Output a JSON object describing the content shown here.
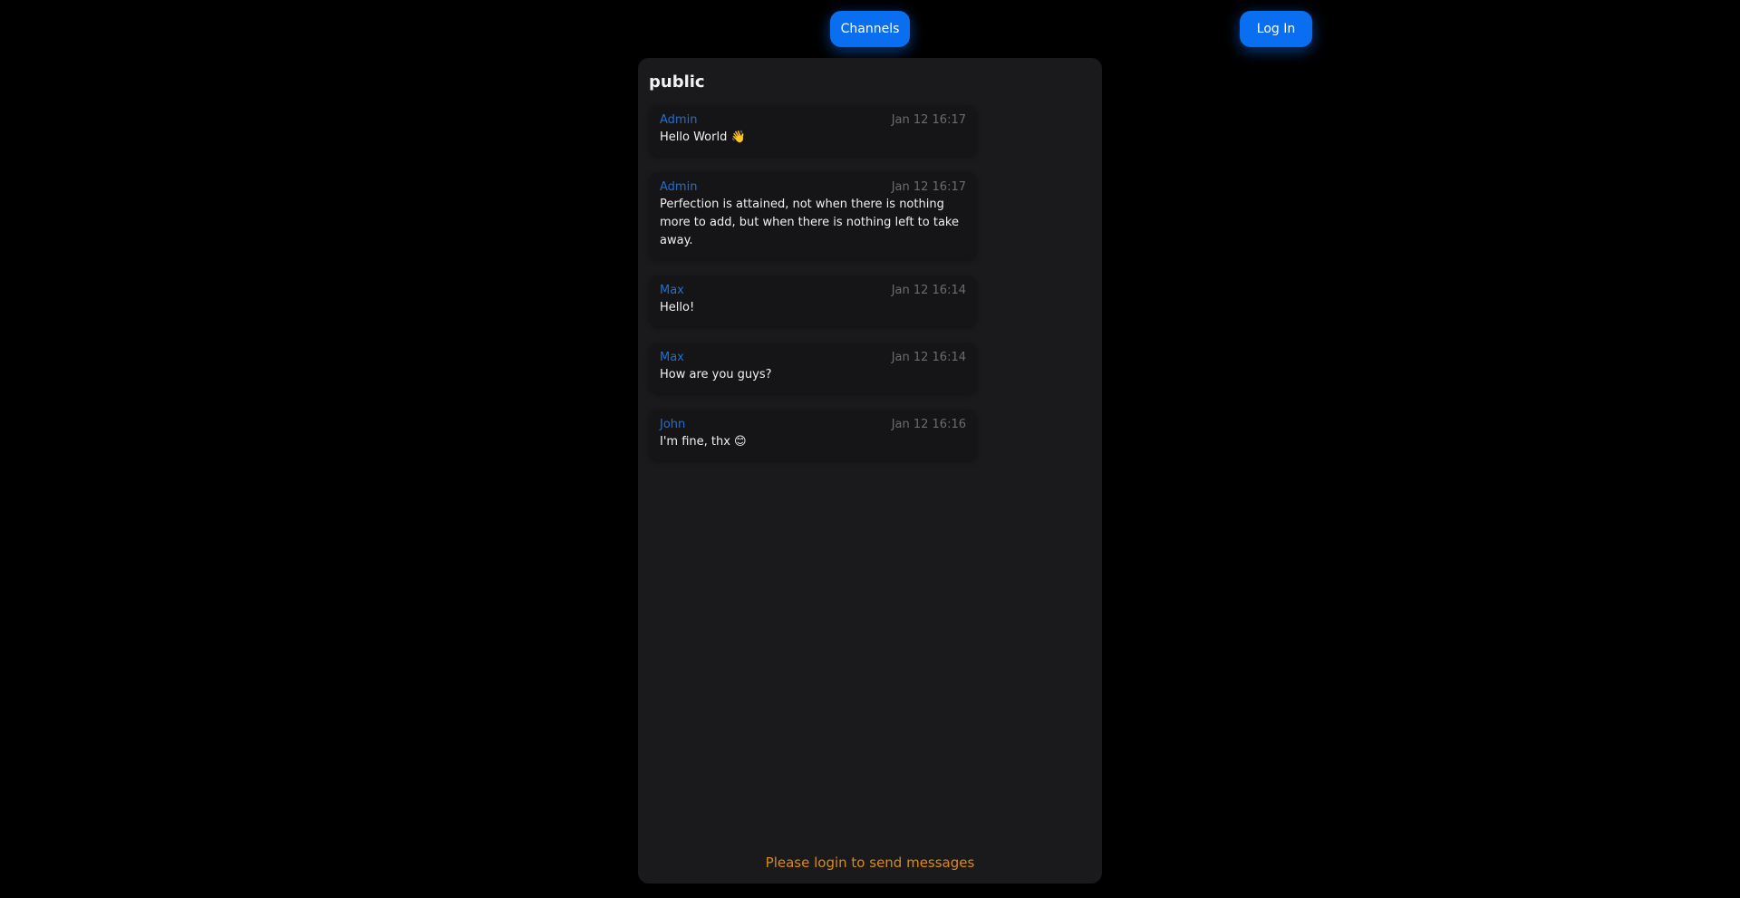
{
  "header": {
    "channels_label": "Channels",
    "login_label": "Log In"
  },
  "channel": {
    "name": "public"
  },
  "messages": [
    {
      "author": "Admin",
      "time": "Jan 12 16:17",
      "text": "Hello World 👋"
    },
    {
      "author": "Admin",
      "time": "Jan 12 16:17",
      "text": "Perfection is attained, not when there is nothing more to add, but when there is nothing left to take away."
    },
    {
      "author": "Max",
      "time": "Jan 12 16:14",
      "text": "Hello!"
    },
    {
      "author": "Max",
      "time": "Jan 12 16:14",
      "text": "How are you guys?"
    },
    {
      "author": "John",
      "time": "Jan 12 16:16",
      "text": "I'm fine, thx 😊"
    }
  ],
  "footer": {
    "login_prompt": "Please login to send messages"
  },
  "colors": {
    "accent": "#0a6ef0",
    "author": "#1f6fd6",
    "warning": "#d98a1a",
    "panel": "#1a1a1c",
    "background": "#000000"
  }
}
